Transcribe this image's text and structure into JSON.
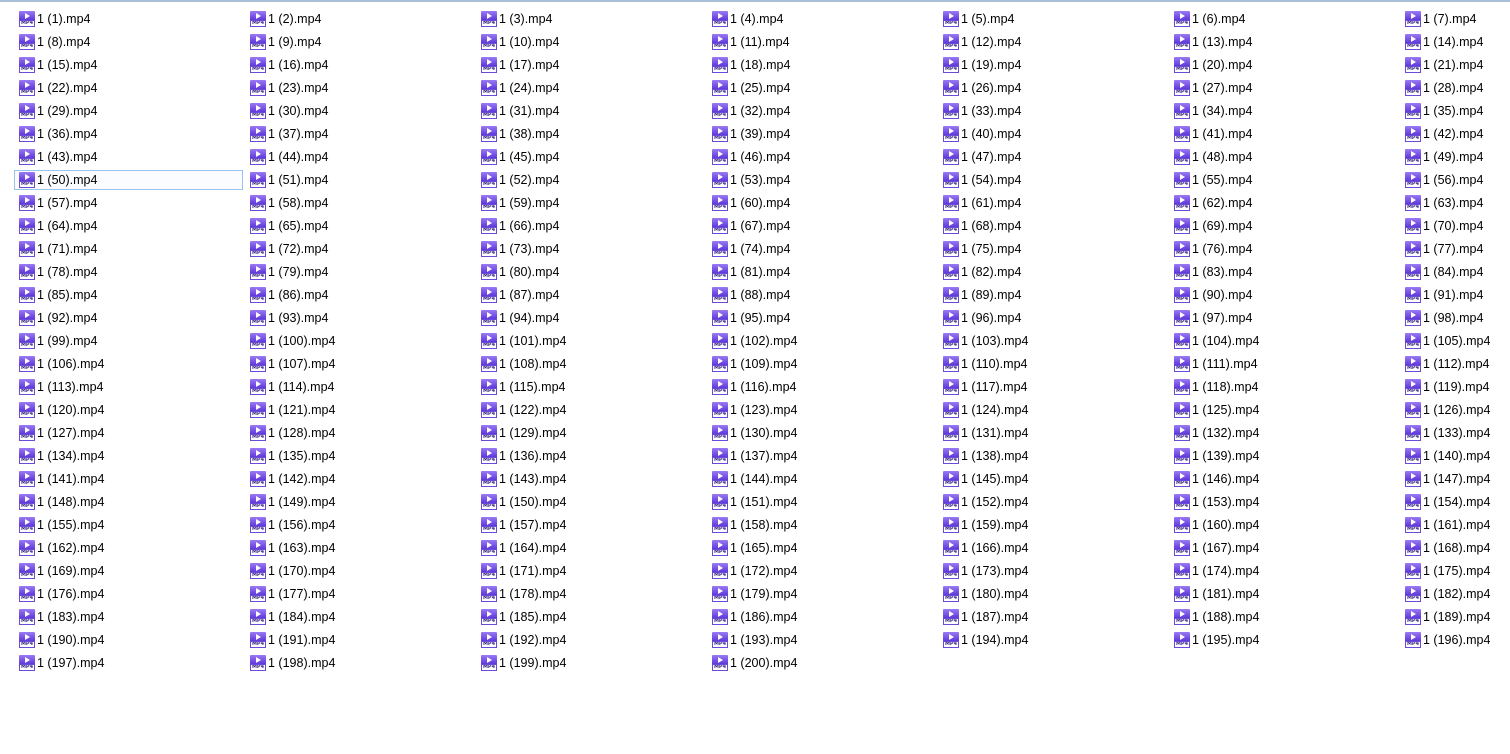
{
  "window": {
    "title": ""
  },
  "files": {
    "icon": "mp4-video-file-icon",
    "icon_label": "MP4",
    "icon_color": "#6a3fe0",
    "selected_index": 49,
    "items": [
      "1 (1).mp4",
      "1 (2).mp4",
      "1 (3).mp4",
      "1 (4).mp4",
      "1 (5).mp4",
      "1 (6).mp4",
      "1 (7).mp4",
      "1 (8).mp4",
      "1 (9).mp4",
      "1 (10).mp4",
      "1 (11).mp4",
      "1 (12).mp4",
      "1 (13).mp4",
      "1 (14).mp4",
      "1 (15).mp4",
      "1 (16).mp4",
      "1 (17).mp4",
      "1 (18).mp4",
      "1 (19).mp4",
      "1 (20).mp4",
      "1 (21).mp4",
      "1 (22).mp4",
      "1 (23).mp4",
      "1 (24).mp4",
      "1 (25).mp4",
      "1 (26).mp4",
      "1 (27).mp4",
      "1 (28).mp4",
      "1 (29).mp4",
      "1 (30).mp4",
      "1 (31).mp4",
      "1 (32).mp4",
      "1 (33).mp4",
      "1 (34).mp4",
      "1 (35).mp4",
      "1 (36).mp4",
      "1 (37).mp4",
      "1 (38).mp4",
      "1 (39).mp4",
      "1 (40).mp4",
      "1 (41).mp4",
      "1 (42).mp4",
      "1 (43).mp4",
      "1 (44).mp4",
      "1 (45).mp4",
      "1 (46).mp4",
      "1 (47).mp4",
      "1 (48).mp4",
      "1 (49).mp4",
      "1 (50).mp4",
      "1 (51).mp4",
      "1 (52).mp4",
      "1 (53).mp4",
      "1 (54).mp4",
      "1 (55).mp4",
      "1 (56).mp4",
      "1 (57).mp4",
      "1 (58).mp4",
      "1 (59).mp4",
      "1 (60).mp4",
      "1 (61).mp4",
      "1 (62).mp4",
      "1 (63).mp4",
      "1 (64).mp4",
      "1 (65).mp4",
      "1 (66).mp4",
      "1 (67).mp4",
      "1 (68).mp4",
      "1 (69).mp4",
      "1 (70).mp4",
      "1 (71).mp4",
      "1 (72).mp4",
      "1 (73).mp4",
      "1 (74).mp4",
      "1 (75).mp4",
      "1 (76).mp4",
      "1 (77).mp4",
      "1 (78).mp4",
      "1 (79).mp4",
      "1 (80).mp4",
      "1 (81).mp4",
      "1 (82).mp4",
      "1 (83).mp4",
      "1 (84).mp4",
      "1 (85).mp4",
      "1 (86).mp4",
      "1 (87).mp4",
      "1 (88).mp4",
      "1 (89).mp4",
      "1 (90).mp4",
      "1 (91).mp4",
      "1 (92).mp4",
      "1 (93).mp4",
      "1 (94).mp4",
      "1 (95).mp4",
      "1 (96).mp4",
      "1 (97).mp4",
      "1 (98).mp4",
      "1 (99).mp4",
      "1 (100).mp4",
      "1 (101).mp4",
      "1 (102).mp4",
      "1 (103).mp4",
      "1 (104).mp4",
      "1 (105).mp4",
      "1 (106).mp4",
      "1 (107).mp4",
      "1 (108).mp4",
      "1 (109).mp4",
      "1 (110).mp4",
      "1 (111).mp4",
      "1 (112).mp4",
      "1 (113).mp4",
      "1 (114).mp4",
      "1 (115).mp4",
      "1 (116).mp4",
      "1 (117).mp4",
      "1 (118).mp4",
      "1 (119).mp4",
      "1 (120).mp4",
      "1 (121).mp4",
      "1 (122).mp4",
      "1 (123).mp4",
      "1 (124).mp4",
      "1 (125).mp4",
      "1 (126).mp4",
      "1 (127).mp4",
      "1 (128).mp4",
      "1 (129).mp4",
      "1 (130).mp4",
      "1 (131).mp4",
      "1 (132).mp4",
      "1 (133).mp4",
      "1 (134).mp4",
      "1 (135).mp4",
      "1 (136).mp4",
      "1 (137).mp4",
      "1 (138).mp4",
      "1 (139).mp4",
      "1 (140).mp4",
      "1 (141).mp4",
      "1 (142).mp4",
      "1 (143).mp4",
      "1 (144).mp4",
      "1 (145).mp4",
      "1 (146).mp4",
      "1 (147).mp4",
      "1 (148).mp4",
      "1 (149).mp4",
      "1 (150).mp4",
      "1 (151).mp4",
      "1 (152).mp4",
      "1 (153).mp4",
      "1 (154).mp4",
      "1 (155).mp4",
      "1 (156).mp4",
      "1 (157).mp4",
      "1 (158).mp4",
      "1 (159).mp4",
      "1 (160).mp4",
      "1 (161).mp4",
      "1 (162).mp4",
      "1 (163).mp4",
      "1 (164).mp4",
      "1 (165).mp4",
      "1 (166).mp4",
      "1 (167).mp4",
      "1 (168).mp4",
      "1 (169).mp4",
      "1 (170).mp4",
      "1 (171).mp4",
      "1 (172).mp4",
      "1 (173).mp4",
      "1 (174).mp4",
      "1 (175).mp4",
      "1 (176).mp4",
      "1 (177).mp4",
      "1 (178).mp4",
      "1 (179).mp4",
      "1 (180).mp4",
      "1 (181).mp4",
      "1 (182).mp4",
      "1 (183).mp4",
      "1 (184).mp4",
      "1 (185).mp4",
      "1 (186).mp4",
      "1 (187).mp4",
      "1 (188).mp4",
      "1 (189).mp4",
      "1 (190).mp4",
      "1 (191).mp4",
      "1 (192).mp4",
      "1 (193).mp4",
      "1 (194).mp4",
      "1 (195).mp4",
      "1 (196).mp4",
      "1 (197).mp4",
      "1 (198).mp4",
      "1 (199).mp4",
      "1 (200).mp4"
    ]
  }
}
